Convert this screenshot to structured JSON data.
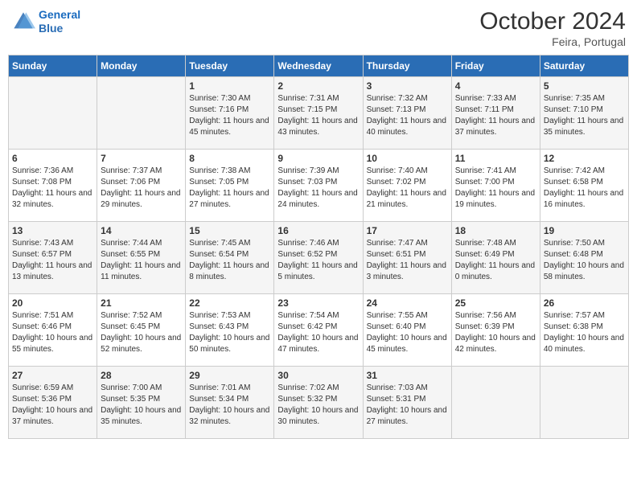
{
  "header": {
    "logo_line1": "General",
    "logo_line2": "Blue",
    "month": "October 2024",
    "location": "Feira, Portugal"
  },
  "weekdays": [
    "Sunday",
    "Monday",
    "Tuesday",
    "Wednesday",
    "Thursday",
    "Friday",
    "Saturday"
  ],
  "weeks": [
    [
      {
        "day": "",
        "sunrise": "",
        "sunset": "",
        "daylight": ""
      },
      {
        "day": "",
        "sunrise": "",
        "sunset": "",
        "daylight": ""
      },
      {
        "day": "1",
        "sunrise": "Sunrise: 7:30 AM",
        "sunset": "Sunset: 7:16 PM",
        "daylight": "Daylight: 11 hours and 45 minutes."
      },
      {
        "day": "2",
        "sunrise": "Sunrise: 7:31 AM",
        "sunset": "Sunset: 7:15 PM",
        "daylight": "Daylight: 11 hours and 43 minutes."
      },
      {
        "day": "3",
        "sunrise": "Sunrise: 7:32 AM",
        "sunset": "Sunset: 7:13 PM",
        "daylight": "Daylight: 11 hours and 40 minutes."
      },
      {
        "day": "4",
        "sunrise": "Sunrise: 7:33 AM",
        "sunset": "Sunset: 7:11 PM",
        "daylight": "Daylight: 11 hours and 37 minutes."
      },
      {
        "day": "5",
        "sunrise": "Sunrise: 7:35 AM",
        "sunset": "Sunset: 7:10 PM",
        "daylight": "Daylight: 11 hours and 35 minutes."
      }
    ],
    [
      {
        "day": "6",
        "sunrise": "Sunrise: 7:36 AM",
        "sunset": "Sunset: 7:08 PM",
        "daylight": "Daylight: 11 hours and 32 minutes."
      },
      {
        "day": "7",
        "sunrise": "Sunrise: 7:37 AM",
        "sunset": "Sunset: 7:06 PM",
        "daylight": "Daylight: 11 hours and 29 minutes."
      },
      {
        "day": "8",
        "sunrise": "Sunrise: 7:38 AM",
        "sunset": "Sunset: 7:05 PM",
        "daylight": "Daylight: 11 hours and 27 minutes."
      },
      {
        "day": "9",
        "sunrise": "Sunrise: 7:39 AM",
        "sunset": "Sunset: 7:03 PM",
        "daylight": "Daylight: 11 hours and 24 minutes."
      },
      {
        "day": "10",
        "sunrise": "Sunrise: 7:40 AM",
        "sunset": "Sunset: 7:02 PM",
        "daylight": "Daylight: 11 hours and 21 minutes."
      },
      {
        "day": "11",
        "sunrise": "Sunrise: 7:41 AM",
        "sunset": "Sunset: 7:00 PM",
        "daylight": "Daylight: 11 hours and 19 minutes."
      },
      {
        "day": "12",
        "sunrise": "Sunrise: 7:42 AM",
        "sunset": "Sunset: 6:58 PM",
        "daylight": "Daylight: 11 hours and 16 minutes."
      }
    ],
    [
      {
        "day": "13",
        "sunrise": "Sunrise: 7:43 AM",
        "sunset": "Sunset: 6:57 PM",
        "daylight": "Daylight: 11 hours and 13 minutes."
      },
      {
        "day": "14",
        "sunrise": "Sunrise: 7:44 AM",
        "sunset": "Sunset: 6:55 PM",
        "daylight": "Daylight: 11 hours and 11 minutes."
      },
      {
        "day": "15",
        "sunrise": "Sunrise: 7:45 AM",
        "sunset": "Sunset: 6:54 PM",
        "daylight": "Daylight: 11 hours and 8 minutes."
      },
      {
        "day": "16",
        "sunrise": "Sunrise: 7:46 AM",
        "sunset": "Sunset: 6:52 PM",
        "daylight": "Daylight: 11 hours and 5 minutes."
      },
      {
        "day": "17",
        "sunrise": "Sunrise: 7:47 AM",
        "sunset": "Sunset: 6:51 PM",
        "daylight": "Daylight: 11 hours and 3 minutes."
      },
      {
        "day": "18",
        "sunrise": "Sunrise: 7:48 AM",
        "sunset": "Sunset: 6:49 PM",
        "daylight": "Daylight: 11 hours and 0 minutes."
      },
      {
        "day": "19",
        "sunrise": "Sunrise: 7:50 AM",
        "sunset": "Sunset: 6:48 PM",
        "daylight": "Daylight: 10 hours and 58 minutes."
      }
    ],
    [
      {
        "day": "20",
        "sunrise": "Sunrise: 7:51 AM",
        "sunset": "Sunset: 6:46 PM",
        "daylight": "Daylight: 10 hours and 55 minutes."
      },
      {
        "day": "21",
        "sunrise": "Sunrise: 7:52 AM",
        "sunset": "Sunset: 6:45 PM",
        "daylight": "Daylight: 10 hours and 52 minutes."
      },
      {
        "day": "22",
        "sunrise": "Sunrise: 7:53 AM",
        "sunset": "Sunset: 6:43 PM",
        "daylight": "Daylight: 10 hours and 50 minutes."
      },
      {
        "day": "23",
        "sunrise": "Sunrise: 7:54 AM",
        "sunset": "Sunset: 6:42 PM",
        "daylight": "Daylight: 10 hours and 47 minutes."
      },
      {
        "day": "24",
        "sunrise": "Sunrise: 7:55 AM",
        "sunset": "Sunset: 6:40 PM",
        "daylight": "Daylight: 10 hours and 45 minutes."
      },
      {
        "day": "25",
        "sunrise": "Sunrise: 7:56 AM",
        "sunset": "Sunset: 6:39 PM",
        "daylight": "Daylight: 10 hours and 42 minutes."
      },
      {
        "day": "26",
        "sunrise": "Sunrise: 7:57 AM",
        "sunset": "Sunset: 6:38 PM",
        "daylight": "Daylight: 10 hours and 40 minutes."
      }
    ],
    [
      {
        "day": "27",
        "sunrise": "Sunrise: 6:59 AM",
        "sunset": "Sunset: 5:36 PM",
        "daylight": "Daylight: 10 hours and 37 minutes."
      },
      {
        "day": "28",
        "sunrise": "Sunrise: 7:00 AM",
        "sunset": "Sunset: 5:35 PM",
        "daylight": "Daylight: 10 hours and 35 minutes."
      },
      {
        "day": "29",
        "sunrise": "Sunrise: 7:01 AM",
        "sunset": "Sunset: 5:34 PM",
        "daylight": "Daylight: 10 hours and 32 minutes."
      },
      {
        "day": "30",
        "sunrise": "Sunrise: 7:02 AM",
        "sunset": "Sunset: 5:32 PM",
        "daylight": "Daylight: 10 hours and 30 minutes."
      },
      {
        "day": "31",
        "sunrise": "Sunrise: 7:03 AM",
        "sunset": "Sunset: 5:31 PM",
        "daylight": "Daylight: 10 hours and 27 minutes."
      },
      {
        "day": "",
        "sunrise": "",
        "sunset": "",
        "daylight": ""
      },
      {
        "day": "",
        "sunrise": "",
        "sunset": "",
        "daylight": ""
      }
    ]
  ]
}
